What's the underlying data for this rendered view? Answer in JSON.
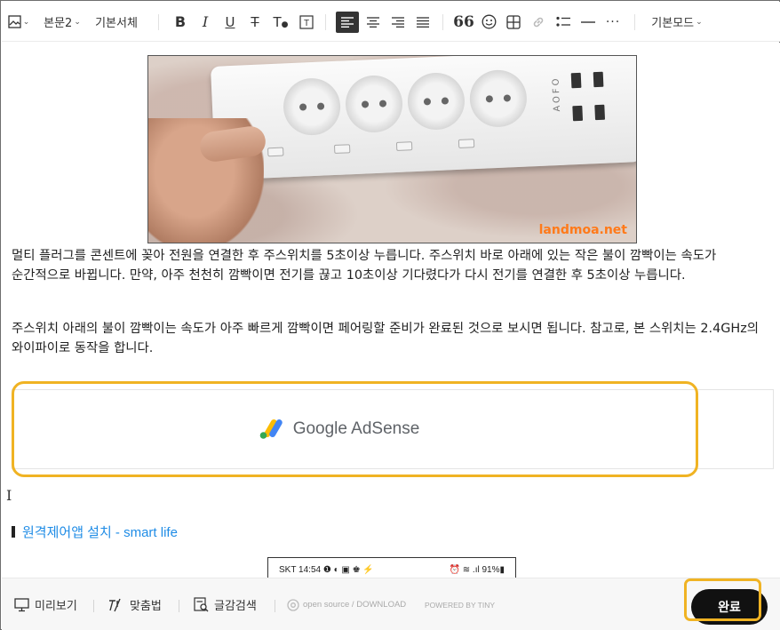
{
  "toolbar": {
    "paragraph_style": "본문2",
    "font_family": "기본서체",
    "mode": "기본모드",
    "more": "···"
  },
  "content": {
    "image_watermark": "landmoa.net",
    "image_brand": "AOFO",
    "paragraph1": "멀티 플러그를 콘센트에 꽂아 전원을 연결한 후 주스위치를 5초이상 누릅니다. 주스위치 바로 아래에 있는 작은 불이 깜빡이는 속도가 순간적으로 바뀝니다. 만약, 아주 천천히 깜빡이면 전기를 끊고 10초이상 기다렸다가 다시 전기를 연결한 후 5초이상 누릅니다.",
    "paragraph2": "주스위치 아래의 불이 깜빡이는 속도가 아주 빠르게 깜빡이면 페어링할 준비가 완료된 것으로 보시면 됩니다. 참고로, 본 스위치는 2.4GHz의 와이파이로 동작을 합니다.",
    "ad_label": "Google AdSense",
    "link_text": "원격제어앱 설치 - smart life",
    "phone_status_left": "SKT 14:54 ❶ ◐ ▣ ♚ ⚡",
    "phone_status_right": "⏰ ≋ .ıl 91%▮"
  },
  "bottombar": {
    "preview": "미리보기",
    "spellcheck": "맞춤법",
    "search": "글감검색",
    "open_source": "open source / DOWNLOAD",
    "powered": "POWERED BY TINY",
    "done": "완료"
  },
  "colors": {
    "highlight": "#f0b323",
    "link": "#1f8ce6",
    "done_bg": "#111111"
  }
}
